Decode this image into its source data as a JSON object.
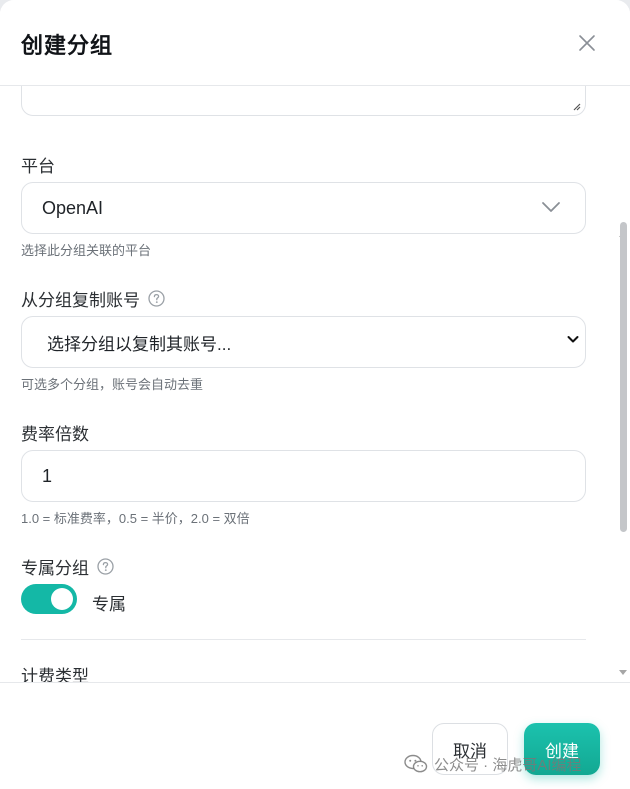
{
  "dialog": {
    "title": "创建分组",
    "close_icon": "close-icon"
  },
  "fields": {
    "platform": {
      "label": "平台",
      "value": "OpenAI",
      "hint": "选择此分组关联的平台",
      "icon": "chevron-down-icon"
    },
    "copy_accounts": {
      "label": "从分组复制账号",
      "help_icon": "help-circle-icon",
      "placeholder": "选择分组以复制其账号...",
      "hint": "可选多个分组，账号会自动去重"
    },
    "rate_multiplier": {
      "label": "费率倍数",
      "value": "1",
      "hint": "1.0 = 标准费率，0.5 = 半价，2.0 = 双倍"
    },
    "exclusive": {
      "label": "专属分组",
      "help_icon": "help-circle-icon",
      "toggle_on": true,
      "toggle_label": "专属"
    },
    "billing_type": {
      "label": "计费类型"
    }
  },
  "footer": {
    "cancel_label": "取消",
    "create_label": "创建"
  },
  "watermark": {
    "text": "公众号 · 海虎哥AI编程",
    "icon": "wechat-icon"
  },
  "colors": {
    "accent": "#14b8a6",
    "border": "#dfe2e6",
    "hint_text": "#6b7178"
  }
}
